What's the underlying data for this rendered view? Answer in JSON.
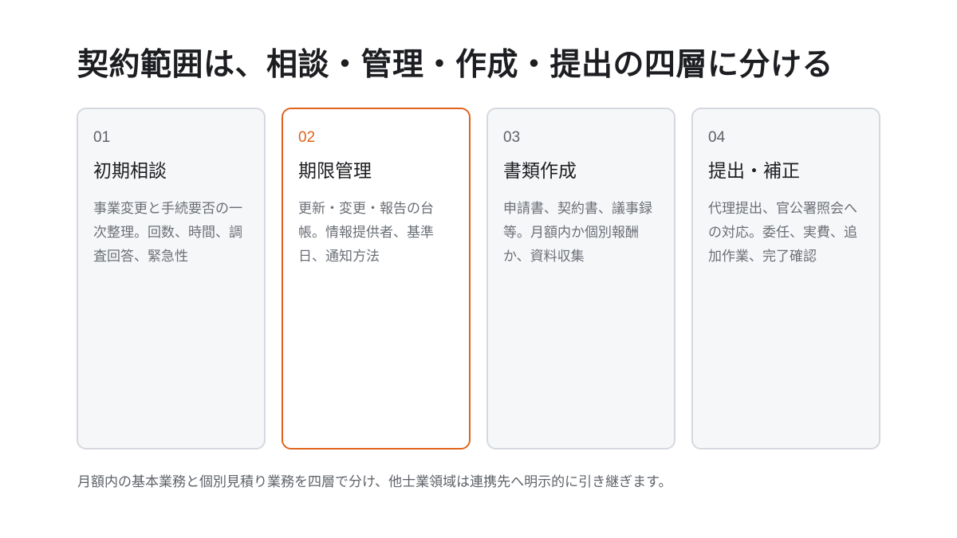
{
  "title": "契約範囲は、相談・管理・作成・提出の四層に分ける",
  "cards": [
    {
      "number": "01",
      "title": "初期相談",
      "description": "事業変更と手続要否の一次整理。回数、時間、調査回答、緊急性"
    },
    {
      "number": "02",
      "title": "期限管理",
      "description": "更新・変更・報告の台帳。情報提供者、基準日、通知方法"
    },
    {
      "number": "03",
      "title": "書類作成",
      "description": "申請書、契約書、議事録等。月額内か個別報酬か、資料収集"
    },
    {
      "number": "04",
      "title": "提出・補正",
      "description": "代理提出、官公署照会への対応。委任、実費、追加作業、完了確認"
    }
  ],
  "footnote": "月額内の基本業務と個別見積り業務を四層で分け、他士業領域は連携先へ明示的に引き継ぎます。",
  "colors": {
    "accent": "#e0631c",
    "card_background": "#f6f7f9",
    "card_border": "#d5d8de"
  }
}
